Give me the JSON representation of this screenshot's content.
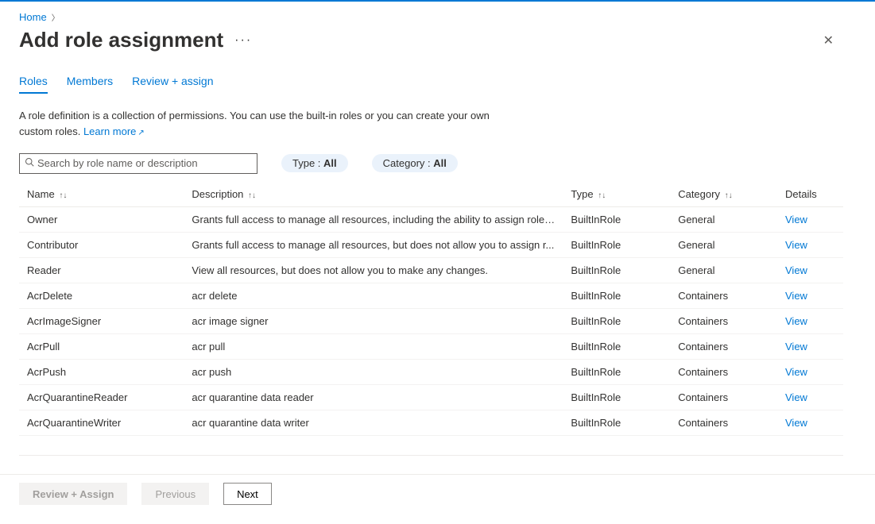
{
  "breadcrumb": {
    "home": "Home"
  },
  "title": "Add role assignment",
  "tabs": [
    {
      "label": "Roles",
      "active": true
    },
    {
      "label": "Members",
      "active": false
    },
    {
      "label": "Review + assign",
      "active": false
    }
  ],
  "description_line1": "A role definition is a collection of permissions. You can use the built-in roles or you can create your own",
  "description_line2_prefix": "custom roles.",
  "learn_more_label": "Learn more",
  "search": {
    "placeholder": "Search by role name or description"
  },
  "filters": {
    "type_label": "Type : ",
    "type_value": "All",
    "category_label": "Category : ",
    "category_value": "All"
  },
  "columns": {
    "name": "Name",
    "description": "Description",
    "type": "Type",
    "category": "Category",
    "details": "Details"
  },
  "view_label": "View",
  "rows": [
    {
      "name": "Owner",
      "description": "Grants full access to manage all resources, including the ability to assign roles...",
      "type": "BuiltInRole",
      "category": "General"
    },
    {
      "name": "Contributor",
      "description": "Grants full access to manage all resources, but does not allow you to assign r...",
      "type": "BuiltInRole",
      "category": "General"
    },
    {
      "name": "Reader",
      "description": "View all resources, but does not allow you to make any changes.",
      "type": "BuiltInRole",
      "category": "General"
    },
    {
      "name": "AcrDelete",
      "description": "acr delete",
      "type": "BuiltInRole",
      "category": "Containers"
    },
    {
      "name": "AcrImageSigner",
      "description": "acr image signer",
      "type": "BuiltInRole",
      "category": "Containers"
    },
    {
      "name": "AcrPull",
      "description": "acr pull",
      "type": "BuiltInRole",
      "category": "Containers"
    },
    {
      "name": "AcrPush",
      "description": "acr push",
      "type": "BuiltInRole",
      "category": "Containers"
    },
    {
      "name": "AcrQuarantineReader",
      "description": "acr quarantine data reader",
      "type": "BuiltInRole",
      "category": "Containers"
    },
    {
      "name": "AcrQuarantineWriter",
      "description": "acr quarantine data writer",
      "type": "BuiltInRole",
      "category": "Containers"
    }
  ],
  "footer": {
    "review_assign": "Review + Assign",
    "previous": "Previous",
    "next": "Next"
  }
}
